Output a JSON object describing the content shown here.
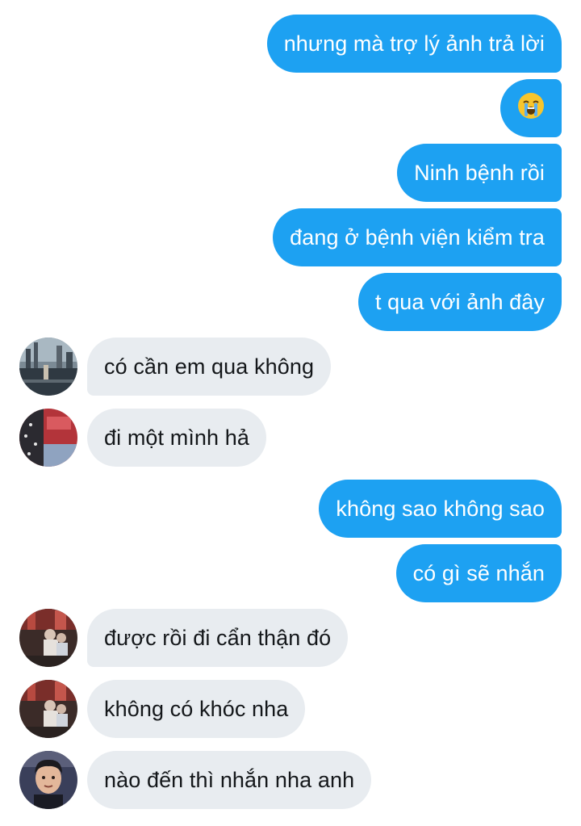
{
  "conversation": {
    "messages": [
      {
        "side": "out",
        "text": "nhưng mà trợ lý ảnh trả lời"
      },
      {
        "side": "out",
        "emoji": "loudly-crying-face"
      },
      {
        "side": "out",
        "text": "Ninh bệnh rồi"
      },
      {
        "side": "out",
        "text": "đang ở bệnh viện kiểm tra"
      },
      {
        "side": "out",
        "text": "t qua với ảnh đây"
      },
      {
        "side": "in",
        "text": "có cần em qua không"
      },
      {
        "side": "in",
        "text": "đi một mình hả"
      },
      {
        "side": "out",
        "text": "không sao không sao"
      },
      {
        "side": "out",
        "text": "có gì sẽ nhắn"
      },
      {
        "side": "in",
        "text": "được rồi đi cẩn thận đó"
      },
      {
        "side": "in",
        "text": "không có khóc nha"
      },
      {
        "side": "in",
        "text": "nào đến thì nhắn nha anh"
      }
    ]
  },
  "colors": {
    "outgoing_bubble": "#1da1f2",
    "incoming_bubble": "#e8ecf0",
    "incoming_text": "#14171a",
    "outgoing_text": "#ffffff"
  }
}
